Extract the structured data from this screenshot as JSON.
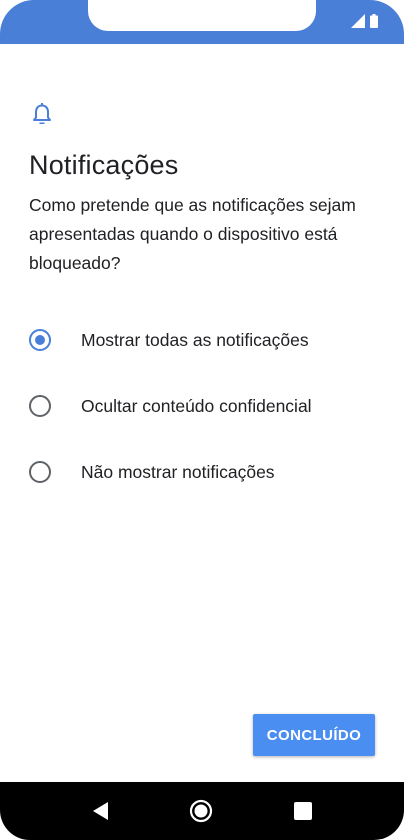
{
  "colors": {
    "accent": "#4a7fd8",
    "button": "#4a8ef2",
    "text": "#202124",
    "radio_off": "#5f6368"
  },
  "status_bar": {
    "icons": [
      "signal-icon",
      "battery-icon"
    ]
  },
  "header": {
    "icon": "bell-icon",
    "title": "Notificações",
    "description": "Como pretende que as notificações sejam apresentadas quando o dispositivo está bloqueado?"
  },
  "options": [
    {
      "label": "Mostrar todas as notificações",
      "selected": true
    },
    {
      "label": "Ocultar conteúdo confidencial",
      "selected": false
    },
    {
      "label": "Não mostrar notificações",
      "selected": false
    }
  ],
  "footer": {
    "done_label": "CONCLUÍDO"
  },
  "nav_bar": {
    "icons": [
      "back-icon",
      "home-icon",
      "recents-icon"
    ]
  }
}
